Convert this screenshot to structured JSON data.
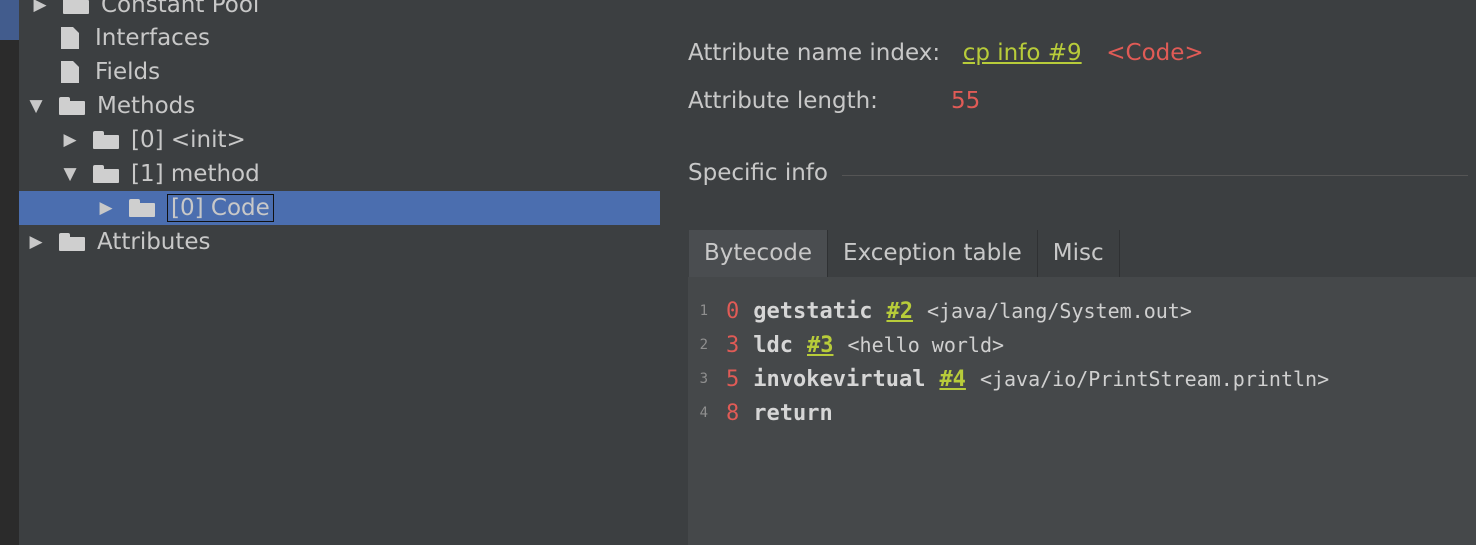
{
  "tree": {
    "items": [
      {
        "label": "Constant Pool"
      },
      {
        "label": "Interfaces"
      },
      {
        "label": "Fields"
      },
      {
        "label": "Methods"
      },
      {
        "label": "[0] <init>"
      },
      {
        "label": "[1] method"
      },
      {
        "label": "[0] Code"
      },
      {
        "label": "Attributes"
      }
    ]
  },
  "details": {
    "attribute_name_index_label": "Attribute name index:",
    "attribute_name_index_value": "cp info #9",
    "attribute_name_index_resolved": "<Code>",
    "attribute_length_label": "Attribute length:",
    "attribute_length_value": "55",
    "specific_info_label": "Specific info"
  },
  "tabs": [
    {
      "label": "Bytecode"
    },
    {
      "label": "Exception table"
    },
    {
      "label": "Misc"
    }
  ],
  "bytecode": [
    {
      "line": "1",
      "offset": "0",
      "opcode": "getstatic",
      "ref": "#2",
      "comment": "<java/lang/System.out>"
    },
    {
      "line": "2",
      "offset": "3",
      "opcode": "ldc",
      "ref": "#3",
      "comment": "<hello world>"
    },
    {
      "line": "3",
      "offset": "5",
      "opcode": "invokevirtual",
      "ref": "#4",
      "comment": "<java/io/PrintStream.println>"
    },
    {
      "line": "4",
      "offset": "8",
      "opcode": "return",
      "ref": "",
      "comment": ""
    }
  ]
}
